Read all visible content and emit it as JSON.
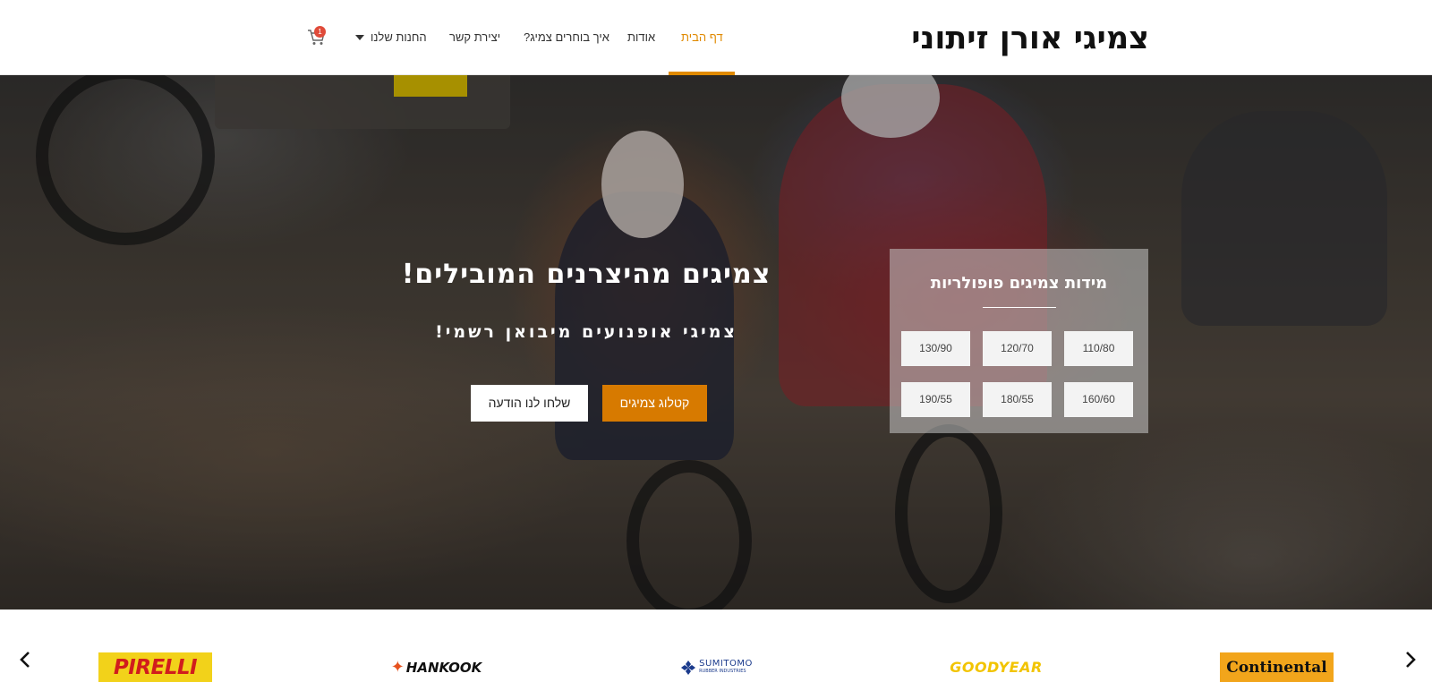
{
  "header": {
    "logo": "צמיגי אורן זיתוני",
    "nav": [
      {
        "label": "דף הבית",
        "active": true
      },
      {
        "label": "אודות",
        "active": false
      },
      {
        "label": "איך בוחרים צמיג?",
        "active": false
      },
      {
        "label": "יצירת קשר",
        "active": false
      },
      {
        "label": "החנות שלנו",
        "active": false,
        "has_dropdown": true
      }
    ],
    "cart": {
      "count": "1",
      "icon": "cart-icon"
    },
    "accent_color": "#e08a00"
  },
  "hero": {
    "title": "צמיגים מהיצרנים המובילים!",
    "subtitle": "צמיגי אופנועים מיבואן רשמי!",
    "primary_button": "קטלוג צמיגים",
    "secondary_button": "שלחו לנו הודעה",
    "primary_color": "#d77a00"
  },
  "sizes": {
    "title": "מידות צמיגים פופולריות",
    "items": [
      "110/80",
      "120/70",
      "130/90",
      "160/60",
      "180/55",
      "190/55"
    ]
  },
  "brands": {
    "prev_icon": "chevron-left-icon",
    "next_icon": "chevron-right-icon",
    "items": [
      {
        "name": "PIRELLI"
      },
      {
        "name": "HANKOOK"
      },
      {
        "name": "SUMITOMO",
        "sub": "RUBBER INDUSTRIES"
      },
      {
        "name": "GOODYEAR"
      },
      {
        "name": "Continental"
      }
    ]
  }
}
